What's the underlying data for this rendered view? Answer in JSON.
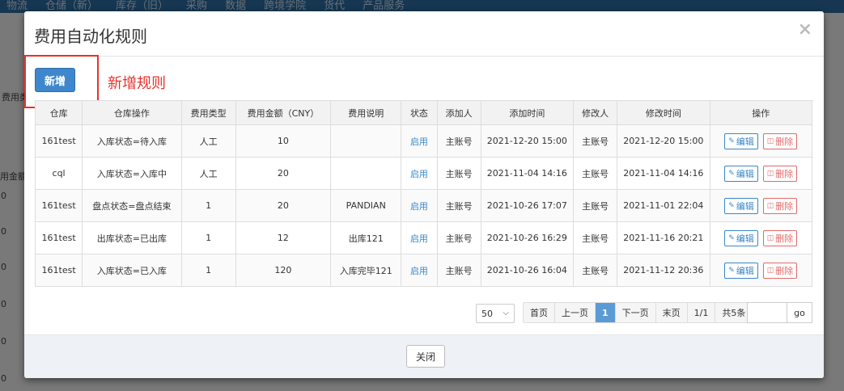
{
  "background": {
    "nav_items": [
      "物流",
      "仓储（新）",
      "库存（旧）",
      "采购",
      "数据",
      "跨境学院",
      "货代",
      "产品服务"
    ],
    "field_label": "费用类",
    "column_label": "用金额",
    "zero_values": [
      "0",
      "0",
      "0",
      "0",
      "0",
      "0"
    ]
  },
  "modal": {
    "title": "费用自动化规则",
    "close_icon": "×",
    "add_button": "新增",
    "add_annotation": "新增规则",
    "table": {
      "headers": [
        "仓库",
        "仓库操作",
        "费用类型",
        "费用金额（CNY）",
        "费用说明",
        "状态",
        "添加人",
        "添加时间",
        "修改人",
        "修改时间",
        "操作"
      ],
      "rows": [
        {
          "warehouse": "161test",
          "operation": "入库状态=待入库",
          "fee_type": "人工",
          "amount": "10",
          "note": "",
          "status": "启用",
          "added_by": "主账号",
          "added_time": "2021-12-20 15:00",
          "modified_by": "主账号",
          "modified_time": "2021-12-20 15:00"
        },
        {
          "warehouse": "cql",
          "operation": "入库状态=入库中",
          "fee_type": "人工",
          "amount": "20",
          "note": "",
          "status": "启用",
          "added_by": "主账号",
          "added_time": "2021-11-04 14:16",
          "modified_by": "主账号",
          "modified_time": "2021-11-04 14:16"
        },
        {
          "warehouse": "161test",
          "operation": "盘点状态=盘点结束",
          "fee_type": "1",
          "amount": "20",
          "note": "PANDIAN",
          "status": "启用",
          "added_by": "主账号",
          "added_time": "2021-10-26 17:07",
          "modified_by": "主账号",
          "modified_time": "2021-11-01 22:04"
        },
        {
          "warehouse": "161test",
          "operation": "出库状态=已出库",
          "fee_type": "1",
          "amount": "12",
          "note": "出库121",
          "status": "启用",
          "added_by": "主账号",
          "added_time": "2021-10-26 16:29",
          "modified_by": "主账号",
          "modified_time": "2021-11-16 20:21"
        },
        {
          "warehouse": "161test",
          "operation": "入库状态=已入库",
          "fee_type": "1",
          "amount": "120",
          "note": "入库完毕121",
          "status": "启用",
          "added_by": "主账号",
          "added_time": "2021-10-26 16:04",
          "modified_by": "主账号",
          "modified_time": "2021-11-12 20:36"
        }
      ],
      "edit_label": "编辑",
      "delete_label": "删除"
    },
    "pagination": {
      "page_size": "50",
      "first": "首页",
      "prev": "上一页",
      "current": "1",
      "next": "下一页",
      "last": "末页",
      "page_info": "1/1",
      "total": "共5条",
      "goto_label": "go"
    },
    "footer_close": "关闭"
  },
  "colors": {
    "primary": "#3f87cc",
    "danger": "#e8322c",
    "link": "#3a87c8"
  }
}
